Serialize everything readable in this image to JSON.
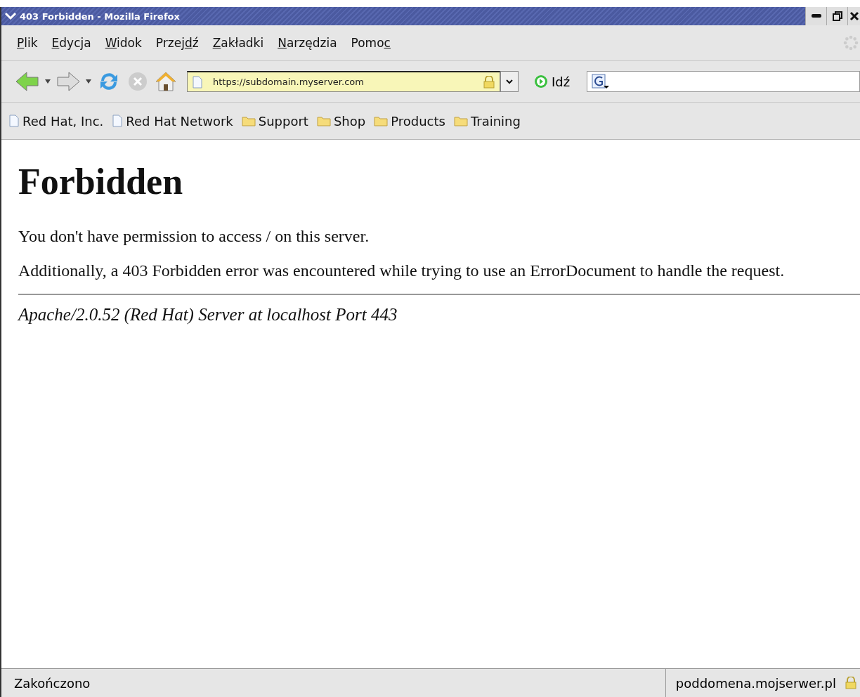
{
  "window": {
    "title": "403 Forbidden - Mozilla Firefox"
  },
  "menu": [
    {
      "key": "P",
      "after": "lik"
    },
    {
      "key": "E",
      "after": "dycja"
    },
    {
      "key": "W",
      "after": "idok"
    },
    {
      "before": "Przej",
      "key": "d",
      "after": "ź"
    },
    {
      "key": "Z",
      "after": "akładki"
    },
    {
      "key": "N",
      "after": "arzędzia"
    },
    {
      "before": "Pomo",
      "key": "c"
    }
  ],
  "toolbar": {
    "url": "https://subdomain.myserver.com",
    "secure": true,
    "go_label": "Idź"
  },
  "bookmarks": [
    {
      "label": "Red Hat, Inc.",
      "kind": "page"
    },
    {
      "label": "Red Hat Network",
      "kind": "page"
    },
    {
      "label": "Support",
      "kind": "folder"
    },
    {
      "label": "Shop",
      "kind": "folder"
    },
    {
      "label": "Products",
      "kind": "folder"
    },
    {
      "label": "Training",
      "kind": "folder"
    }
  ],
  "page": {
    "heading": "Forbidden",
    "paragraphs": [
      "You don't have permission to access / on this server.",
      "Additionally, a 403 Forbidden error was encountered while trying to use an ErrorDocument to handle the request."
    ],
    "address": "Apache/2.0.52 (Red Hat) Server at localhost Port 443"
  },
  "status_bar": {
    "status": "Zakończono",
    "host": "poddomena.mojserwer.pl",
    "secure": true
  }
}
